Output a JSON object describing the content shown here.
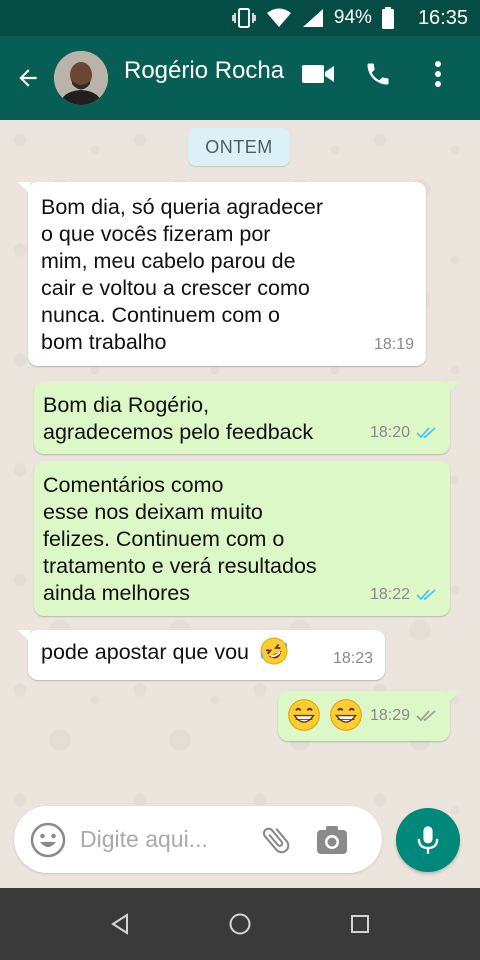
{
  "status_bar": {
    "battery": "94%",
    "time": "16:35"
  },
  "header": {
    "contact_name": "Rogério Rocha"
  },
  "icons": {
    "back": "back-arrow-icon",
    "video": "video-call-icon",
    "phone": "phone-icon",
    "menu": "more-vert-icon"
  },
  "colors": {
    "header": "#075e54",
    "statusbar": "#054d44",
    "outgoing": "#dcf8c6",
    "incoming": "#ffffff",
    "accent": "#00897b",
    "read_tick": "#4fc3f7"
  },
  "chat": {
    "date_separator": "ONTEM",
    "messages": [
      {
        "direction": "in",
        "text": "Bom dia, só queria agradecer\no que vocês fizeram por\nmim, meu cabelo parou de\ncair e voltou a crescer como\nnunca. Continuem com o\nbom trabalho",
        "time": "18:19"
      },
      {
        "direction": "out",
        "text": "Bom dia Rogério,\nagradecemos pelo feedback",
        "time": "18:20",
        "status": "read"
      },
      {
        "direction": "out",
        "text": "Comentários como\nesse nos deixam muito\nfelizes. Continuem com o\ntratamento e verá resultados\nainda melhores",
        "time": "18:22",
        "status": "read"
      },
      {
        "direction": "in",
        "text": "pode apostar que vou",
        "emoji": "rolling-on-floor-laughing",
        "time": "18:23"
      },
      {
        "direction": "out",
        "emoji": "grinning-face x2",
        "time": "18:29",
        "status": "delivered"
      }
    ]
  },
  "composer": {
    "placeholder": "Digite aqui..."
  }
}
